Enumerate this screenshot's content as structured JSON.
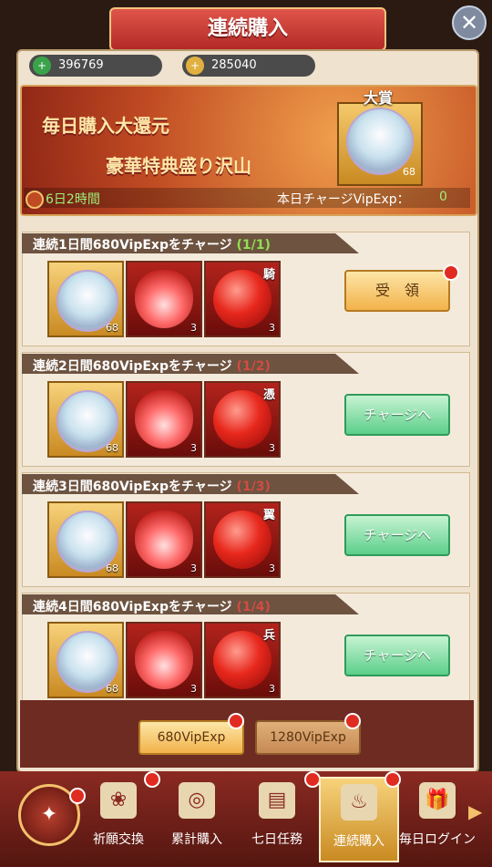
{
  "header": {
    "title": "連続購入"
  },
  "currencies": [
    {
      "icon": "green-gem-icon",
      "value": "396769"
    },
    {
      "icon": "gold-ingot-icon",
      "value": "285040"
    }
  ],
  "banner": {
    "line1": "毎日購入大還元",
    "line2": "豪華特典盛り沢山",
    "grand_prize_label": "大賞",
    "grand_prize_count": "68",
    "timer": "6日2時間",
    "vip_label": "本日チャージVipExp：",
    "vip_value": "0"
  },
  "rows": [
    {
      "title": "連続1日間680VipExpをチャージ",
      "progress": "(1/1)",
      "items": [
        {
          "count": "68"
        },
        {
          "count": "3"
        },
        {
          "count": "3",
          "char": "騎"
        }
      ],
      "button": "受　領"
    },
    {
      "title": "連続2日間680VipExpをチャージ",
      "progress": "(1/2)",
      "items": [
        {
          "count": "68"
        },
        {
          "count": "3"
        },
        {
          "count": "3",
          "char": "憑"
        }
      ],
      "button": "チャージへ"
    },
    {
      "title": "連続3日間680VipExpをチャージ",
      "progress": "(1/3)",
      "items": [
        {
          "count": "68"
        },
        {
          "count": "3"
        },
        {
          "count": "3",
          "char": "翼"
        }
      ],
      "button": "チャージへ"
    },
    {
      "title": "連続4日間680VipExpをチャージ",
      "progress": "(1/4)",
      "items": [
        {
          "count": "68"
        },
        {
          "count": "3"
        },
        {
          "count": "3",
          "char": "兵"
        }
      ],
      "button": "チャージへ"
    }
  ],
  "tiers": [
    "680VipExp",
    "1280VipExp"
  ],
  "nav": [
    {
      "label": "祈願交換",
      "icon": "rose-icon"
    },
    {
      "label": "累計購入",
      "icon": "coins-icon"
    },
    {
      "label": "七日任務",
      "icon": "scroll-icon"
    },
    {
      "label": "連続購入",
      "icon": "pot-icon"
    },
    {
      "label": "毎日ログイン",
      "icon": "gift-icon"
    }
  ],
  "colors": {
    "accent_red": "#b22a26",
    "gold": "#f2b24a",
    "green_btn": "#5ccf8a",
    "progress_done": "#8ee34e",
    "progress_pending": "#d34b43"
  }
}
